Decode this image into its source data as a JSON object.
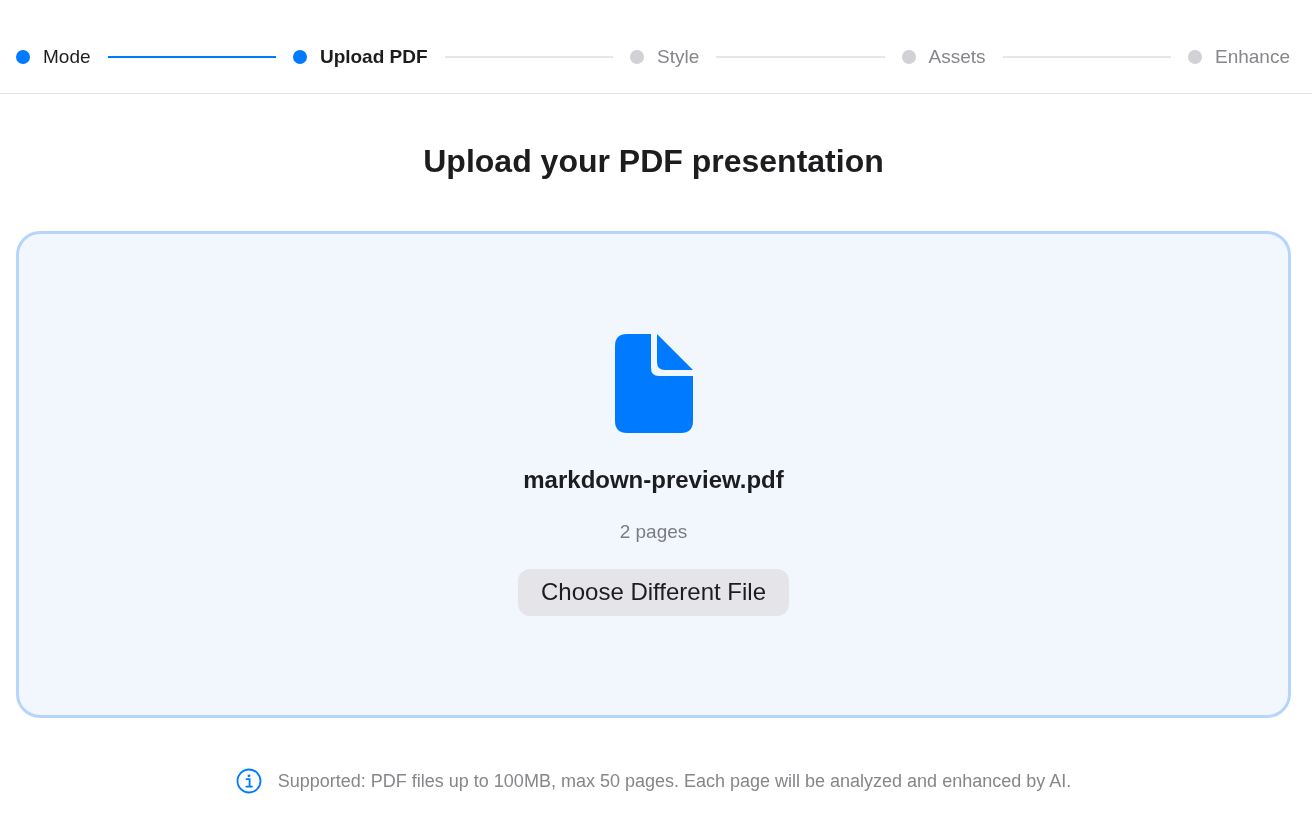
{
  "steps": [
    {
      "label": "Mode",
      "completed": true,
      "selected": false
    },
    {
      "label": "Upload PDF",
      "completed": false,
      "selected": true
    },
    {
      "label": "Style",
      "completed": false,
      "selected": false
    },
    {
      "label": "Assets",
      "completed": false,
      "selected": false
    },
    {
      "label": "Enhance",
      "completed": false,
      "selected": false
    }
  ],
  "heading": "Upload your PDF presentation",
  "dropzone": {
    "file_name": "markdown-preview.pdf",
    "page_count": "2 pages",
    "button": "Choose Different File"
  },
  "note": "Supported: PDF files up to 100MB, max 50 pages. Each page will be analyzed and enhanced by AI."
}
